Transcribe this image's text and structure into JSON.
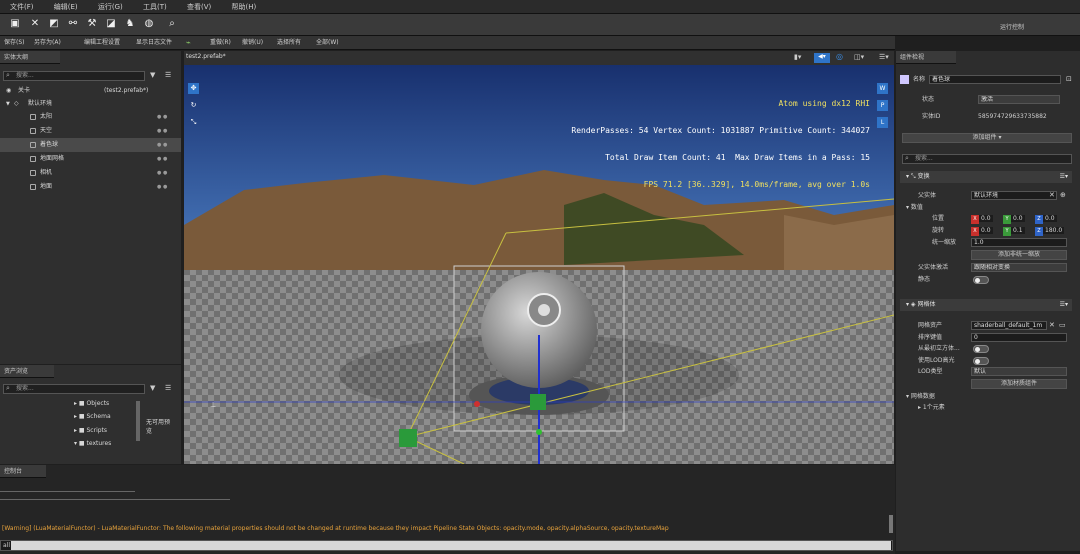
{
  "menu": [
    "文件(F)",
    "编辑(E)",
    "运行(G)",
    "工具(T)",
    "查看(V)",
    "帮助(H)"
  ],
  "toolbar2": {
    "items": [
      "保存(S)",
      "另存为(A)",
      "编辑工程设置",
      "显示日志文件",
      "重做(R)",
      "撤销(U)",
      "选择所有",
      "全部(W)"
    ],
    "right": "运行控制"
  },
  "outliner": {
    "title": "实体大纲",
    "search": "搜索...",
    "root": "关卡",
    "root_file": "(test2.prefab*)",
    "group": "默认环境",
    "items": [
      "太阳",
      "天空",
      "着色球",
      "地面网格",
      "相机",
      "地面"
    ]
  },
  "assets": {
    "title": "资产浏览",
    "search": "搜索...",
    "folders": [
      "Objects",
      "Schema",
      "Scripts",
      "textures"
    ],
    "preview": "无可用预览"
  },
  "viewport": {
    "tab": "test2.prefab*",
    "stats": [
      "Atom using dx12 RHI",
      "RenderPasses: 54 Vertex Count: 1031887 Primitive Count: 344027",
      "Total Draw Item Count: 41  Max Draw Items in a Pass: 15",
      "FPS 71.2 [36..329], 14.0ms/frame, avg over 1.0s"
    ],
    "side_buttons": [
      "W",
      "P",
      "L"
    ]
  },
  "inspector": {
    "title": "组件检视",
    "name_label": "名称",
    "name_value": "着色球",
    "state_label": "状态",
    "state_value": "激活",
    "id_label": "实体ID",
    "id_value": "585974729633735882",
    "add_component": "添加组件 ▾",
    "search": "搜索...",
    "transform": {
      "title": "变换",
      "parent_label": "父实体",
      "parent_value": "默认环境",
      "values_label": "数值",
      "pos_label": "位置",
      "pos": [
        "0.0",
        "0.0",
        "0.0"
      ],
      "rot_label": "旋转",
      "rot": [
        "0.0",
        "0.1",
        "180.0"
      ],
      "scale_label": "统一缩放",
      "scale": "1.0",
      "add_scale": "添加非统一缩放",
      "parent_active_label": "父实体激活",
      "parent_active_value": "跟随相对变换",
      "static_label": "静态"
    },
    "mesh": {
      "title": "网格体",
      "asset_label": "网格资产",
      "asset_value": "shaderball_default_1m",
      "sort_label": "排序键值",
      "sort_value": "0",
      "stat1": "从最初立方体...",
      "stat2": "使用LOD高光",
      "lod_label": "LOD类型",
      "lod_value": "默认",
      "add_material": "添加材质组件",
      "stats_label": "网格数据",
      "stats_sub": "1个元素"
    }
  },
  "console": {
    "title": "控制台",
    "warning": "[Warning] (LuaMaterialFunctor) - LuaMaterialFunctor: The following material properties should not be changed at runtime because they impact Pipeline State Objects: opacity.mode, opacity.alphaSource, opacity.textureMap",
    "prompt": "all"
  },
  "colors": {
    "accent": "#2f74c8",
    "warning": "#e8a33c",
    "sky_top": "#18306e",
    "floor": "#8a8a8a"
  }
}
